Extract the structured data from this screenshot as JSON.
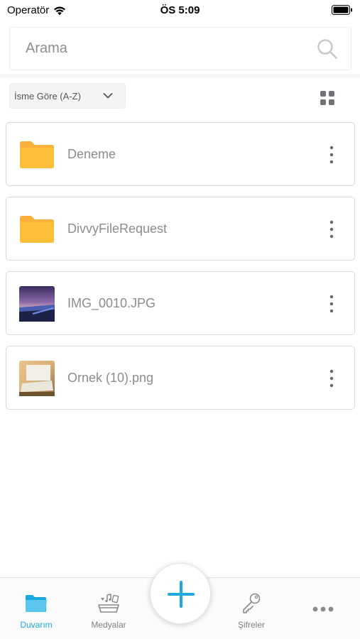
{
  "status_bar": {
    "carrier": "Operatör",
    "time": "ÖS 5:09"
  },
  "search": {
    "placeholder": "Arama"
  },
  "sort": {
    "label": "İsme Göre (A-Z)"
  },
  "files": [
    {
      "name": "Deneme",
      "type": "folder"
    },
    {
      "name": "DivvyFileRequest",
      "type": "folder"
    },
    {
      "name": "IMG_0010.JPG",
      "type": "image"
    },
    {
      "name": "Ornek (10).png",
      "type": "image"
    }
  ],
  "tabbar": {
    "tabs": [
      {
        "label": "Duvarım",
        "icon": "folder-icon",
        "active": true
      },
      {
        "label": "Medyalar",
        "icon": "media-icon",
        "active": false
      },
      {
        "label": "Şifreler",
        "icon": "key-icon",
        "active": false
      },
      {
        "label": "",
        "icon": "more-icon",
        "active": false
      }
    ]
  },
  "colors": {
    "accent": "#1ea8e0",
    "folder": "#fdb62f",
    "text_muted": "#8c8c8c"
  }
}
